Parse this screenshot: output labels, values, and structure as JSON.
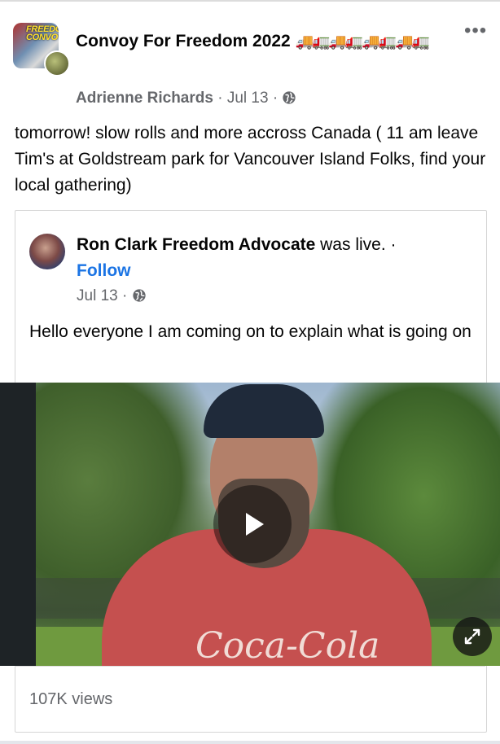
{
  "post": {
    "group_name": "Convoy For Freedom 2022",
    "group_avatar_text": "FREEDOM CONVOY",
    "title_emoji": "🚚🚛🚚🚛🚚🚛🚚🚛",
    "author": "Adrienne Richards",
    "separator": "·",
    "date": "Jul 13",
    "more_label": "•••",
    "text": "tomorrow! slow rolls and more accross Canada ( 11 am leave Tim's at Goldstream park for Vancouver Island Folks, find your local gathering)"
  },
  "shared": {
    "author": "Ron Clark Freedom Advocate",
    "status": "was live.",
    "separator": "·",
    "follow_label": "Follow",
    "date": "Jul 13",
    "text": "Hello everyone I am coming on to explain what is going on",
    "video": {
      "shirt_text": "Coca-Cola"
    },
    "views": "107K views"
  },
  "colors": {
    "link": "#1b74e4",
    "secondary_text": "#65676b"
  },
  "icons": {
    "more": "more-horizontal-icon",
    "globe": "globe-icon",
    "play": "play-icon",
    "expand": "expand-icon"
  }
}
